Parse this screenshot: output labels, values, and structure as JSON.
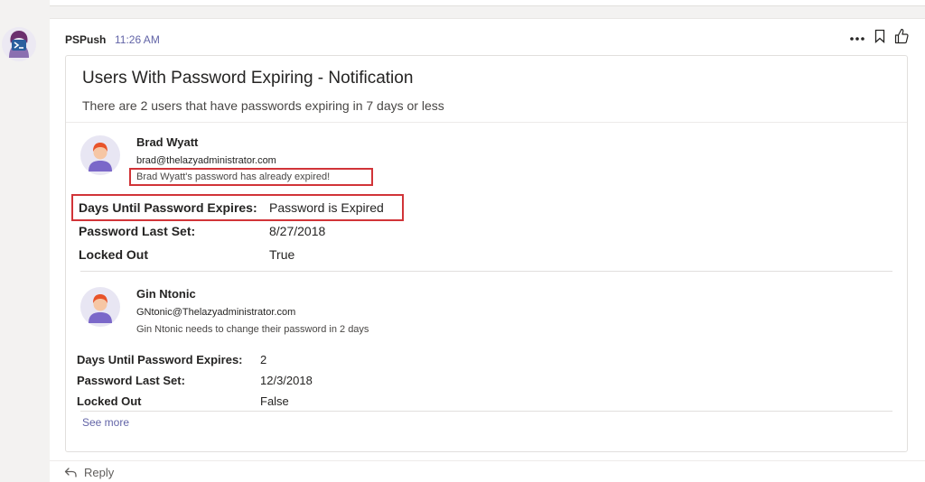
{
  "message": {
    "sender": "PSPush",
    "time": "11:26 AM",
    "actions": [
      "more-options-icon",
      "bookmark-icon",
      "like-icon"
    ]
  },
  "card": {
    "title": "Users With Password Expiring - Notification",
    "subtitle": "There are 2 users that have passwords expiring in 7 days or less",
    "users": [
      {
        "name": "Brad Wyatt",
        "email": "brad@thelazyadministrator.com",
        "note": "Brad Wyatt's password has already expired!",
        "facts": [
          {
            "label": "Days Until Password Expires:",
            "value": "Password is Expired"
          },
          {
            "label": "Password Last Set:",
            "value": "8/27/2018"
          },
          {
            "label": "Locked Out",
            "value": "True"
          }
        ]
      },
      {
        "name": "Gin Ntonic",
        "email": "GNtonic@Thelazyadministrator.com",
        "note": "Gin Ntonic needs to change their password in 2 days",
        "facts": [
          {
            "label": "Days Until Password Expires:",
            "value": "2"
          },
          {
            "label": "Password Last Set:",
            "value": "12/3/2018"
          },
          {
            "label": "Locked Out",
            "value": "False"
          }
        ]
      }
    ],
    "see_more": "See more"
  },
  "reply": {
    "label": "Reply"
  },
  "colors": {
    "accent": "#6264a7",
    "highlight": "#d13438",
    "avatar_bg": "#e8e6f3",
    "avatar_hair": "#e8542a",
    "avatar_shirt": "#7b68c9"
  }
}
